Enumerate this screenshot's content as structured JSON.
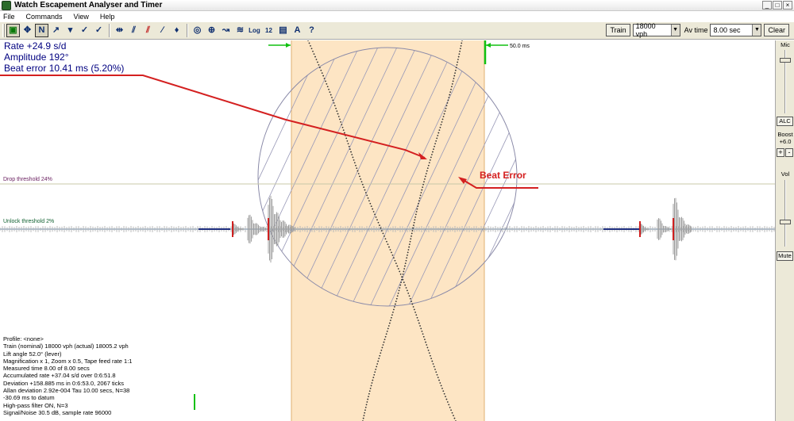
{
  "window": {
    "title": "Watch Escapement Analyser and Timer"
  },
  "menu": [
    "File",
    "Commands",
    "View",
    "Help"
  ],
  "toolbar": {
    "icons": [
      "record-icon",
      "move-icon",
      "waveform-icon",
      "lift-angle-icon",
      "flag-icon",
      "tape-icon",
      "tape-color-icon",
      "collapse-icon",
      "slash-icon",
      "slash-red-icon",
      "pen-icon",
      "drop-icon",
      "globe-icon",
      "expand-icon",
      "trace-icon",
      "multi-trace-icon",
      "log-icon",
      "numbers-icon",
      "chart-icon",
      "amplitude-icon",
      "help-cursor-icon"
    ],
    "icon_glyphs": [
      "▣",
      "✥",
      "N",
      "↗",
      "▾",
      "✓",
      "✓",
      "⇹",
      "⫽",
      "⫽",
      "∕",
      "♦",
      "◎",
      "⊕",
      "↝",
      "≋",
      "Log",
      "12",
      "▤",
      "A",
      "?"
    ],
    "log_label": "Log",
    "train_button": "Train",
    "train_value": "18000 vph",
    "av_time_label": "Av time",
    "av_time_value": "8.00 sec",
    "clear_button": "Clear"
  },
  "readout": {
    "rate": "Rate  +24.9 s/d",
    "amplitude": "Amplitude 192°",
    "beat_error": "Beat error 10.41 ms (5.20%)"
  },
  "plot": {
    "scale_label": "50.0 ms",
    "drop_threshold": "Drop threshold 24%",
    "unlock_threshold": "Unlock threshold 2%",
    "annotation": "Beat Error",
    "colors": {
      "band": "#fde5c4",
      "annotation": "#d42020",
      "trace": "#202020",
      "ring": "#8a8aa8"
    }
  },
  "info": [
    "Profile: <none>",
    "Train (nominal) 18000 vph (actual) 18005.2 vph",
    "Lift angle  52.0° (lever)",
    "Magnification x 1, Zoom x 0.5, Tape feed rate 1:1",
    "Measured time 8.00 of 8.00 secs",
    "Accumulated rate +37.04 s/d over 0:6:51.8",
    "Deviation +158.885 ms in 0:6:53.0, 2067 ticks",
    "Allan deviation 2.92e-004 Tau 10.00 secs, N=38",
    " -30.69 ms to datum",
    "High-pass filter ON, N=3",
    "Signal/Noise 30.5 dB, sample rate 96000"
  ],
  "right_panel": {
    "mic_label": "Mic",
    "alc_button": "ALC",
    "boost_label": "Boost",
    "boost_value": "+6.0",
    "plus": "+",
    "minus": "-",
    "vol_label": "Vol",
    "mute_button": "Mute"
  }
}
